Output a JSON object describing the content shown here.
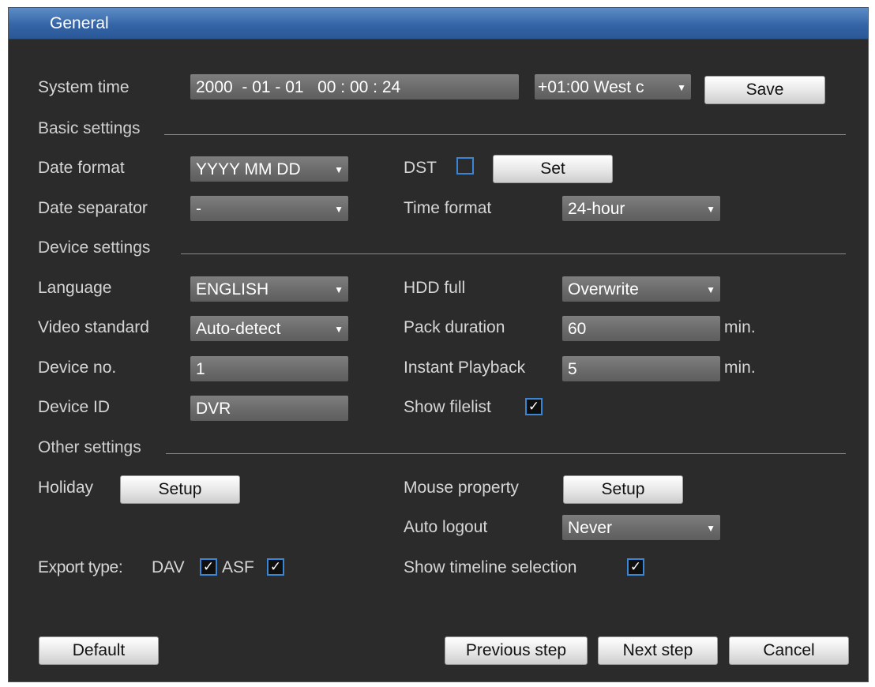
{
  "window": {
    "title": "General"
  },
  "system_time": {
    "label": "System time",
    "value": "2000  - 01 - 01   00 : 00 : 24",
    "timezone": "+01:00 West c",
    "save_label": "Save"
  },
  "basic": {
    "heading": "Basic settings",
    "date_format": {
      "label": "Date format",
      "value": "YYYY MM DD"
    },
    "dst": {
      "label": "DST",
      "checked": false,
      "set_label": "Set"
    },
    "date_separator": {
      "label": "Date separator",
      "value": "-"
    },
    "time_format": {
      "label": "Time format",
      "value": "24-hour"
    }
  },
  "device": {
    "heading": "Device settings",
    "language": {
      "label": "Language",
      "value": "ENGLISH"
    },
    "hdd_full": {
      "label": "HDD full",
      "value": "Overwrite"
    },
    "video_standard": {
      "label": "Video standard",
      "value": "Auto-detect"
    },
    "pack_duration": {
      "label": "Pack duration",
      "value": "60",
      "unit": "min."
    },
    "device_no": {
      "label": "Device no.",
      "value": "1"
    },
    "instant_playback": {
      "label": "Instant Playback",
      "value": "5",
      "unit": "min."
    },
    "device_id": {
      "label": "Device ID",
      "value": "DVR"
    },
    "show_filelist": {
      "label": "Show filelist",
      "checked": true
    }
  },
  "other": {
    "heading": "Other settings",
    "holiday": {
      "label": "Holiday",
      "button": "Setup"
    },
    "mouse_property": {
      "label": "Mouse property",
      "button": "Setup"
    },
    "auto_logout": {
      "label": "Auto logout",
      "value": "Never"
    },
    "export_type": {
      "label": "Export type:",
      "dav_label": "DAV",
      "dav_checked": true,
      "asf_label": "ASF",
      "asf_checked": true
    },
    "show_timeline": {
      "label": "Show timeline selection",
      "checked": true
    }
  },
  "footer": {
    "default_label": "Default",
    "previous_label": "Previous step",
    "next_label": "Next step",
    "cancel_label": "Cancel"
  },
  "glyphs": {
    "dropdown": "▼",
    "check": "✓"
  },
  "colors": {
    "title_bar": "#3565a7",
    "panel": "#2b2b2b",
    "checkbox_border": "#3a86d6"
  }
}
